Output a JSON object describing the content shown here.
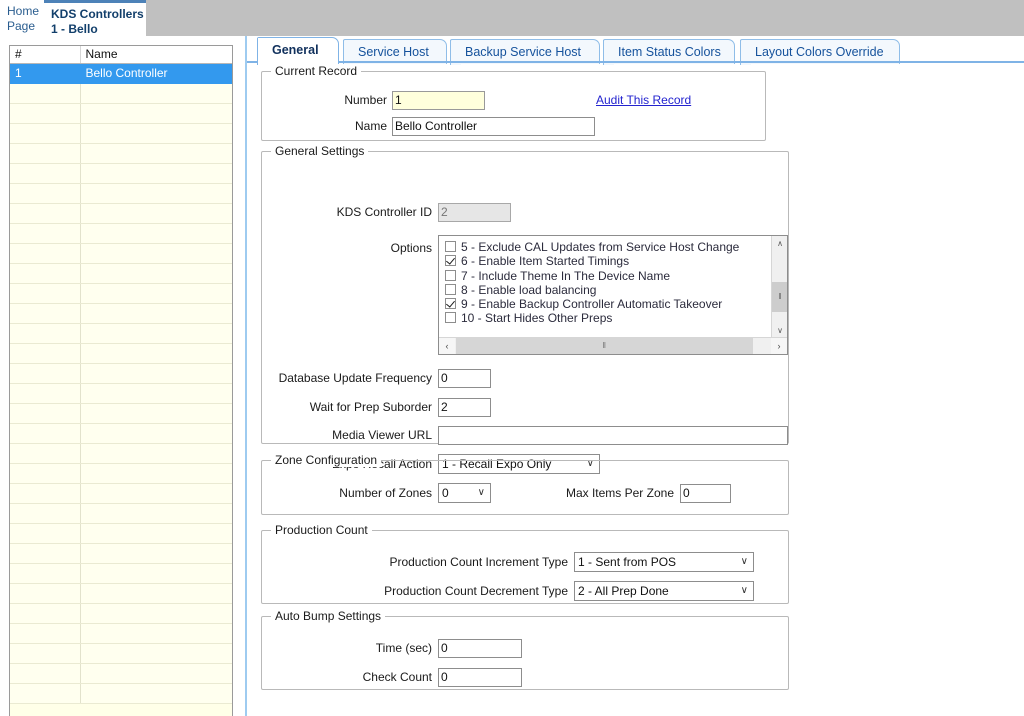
{
  "breadcrumb": {
    "home_line1": "Home",
    "home_line2": "Page",
    "current_line1": "KDS Controllers",
    "current_line2": "1 - Bello"
  },
  "record_list": {
    "columns": [
      "#",
      "Name"
    ],
    "rows": [
      {
        "num": "1",
        "name": "Bello Controller",
        "selected": true
      }
    ],
    "empty_row_count": 31
  },
  "tabs": [
    {
      "label": "General",
      "active": true
    },
    {
      "label": "Service Host",
      "active": false
    },
    {
      "label": "Backup Service Host",
      "active": false
    },
    {
      "label": "Item Status Colors",
      "active": false
    },
    {
      "label": "Layout Colors Override",
      "active": false
    }
  ],
  "current_record": {
    "legend": "Current Record",
    "number_label": "Number",
    "number_value": "1",
    "name_label": "Name",
    "name_value": "Bello Controller",
    "audit_link": "Audit This Record"
  },
  "general_settings": {
    "legend": "General Settings",
    "kds_controller_id_label": "KDS Controller ID",
    "kds_controller_id_value": "2",
    "options_label": "Options",
    "options": [
      {
        "label": "5 - Exclude CAL Updates from Service Host Change",
        "checked": false
      },
      {
        "label": "6 - Enable Item Started Timings",
        "checked": true
      },
      {
        "label": "7 - Include Theme In The Device Name",
        "checked": false
      },
      {
        "label": "8 - Enable load balancing",
        "checked": false
      },
      {
        "label": "9 - Enable Backup Controller Automatic Takeover",
        "checked": true
      },
      {
        "label": "10 - Start Hides Other Preps",
        "checked": false
      }
    ],
    "db_update_label": "Database Update Frequency",
    "db_update_value": "0",
    "wait_prep_label": "Wait for Prep Suborder",
    "wait_prep_value": "2",
    "media_url_label": "Media Viewer URL",
    "media_url_value": "",
    "expo_recall_label": "Expo Recall Action",
    "expo_recall_value": "1 - Recall Expo Only"
  },
  "zone_configuration": {
    "legend": "Zone Configuration",
    "zones_label": "Number of Zones",
    "zones_value": "0",
    "max_items_label": "Max Items Per Zone",
    "max_items_value": "0"
  },
  "production_count": {
    "legend": "Production Count",
    "increment_label": "Production Count Increment Type",
    "increment_value": "1 - Sent from POS",
    "decrement_label": "Production Count Decrement Type",
    "decrement_value": "2 - All Prep Done"
  },
  "auto_bump": {
    "legend": "Auto Bump Settings",
    "time_label": "Time (sec)",
    "time_value": "0",
    "check_count_label": "Check Count",
    "check_count_value": "0"
  },
  "icons": {
    "caret_down": "∨",
    "scroll_up": "∧",
    "scroll_down": "∨",
    "scroll_left": "‹",
    "scroll_right": "›",
    "grip": "‖"
  }
}
